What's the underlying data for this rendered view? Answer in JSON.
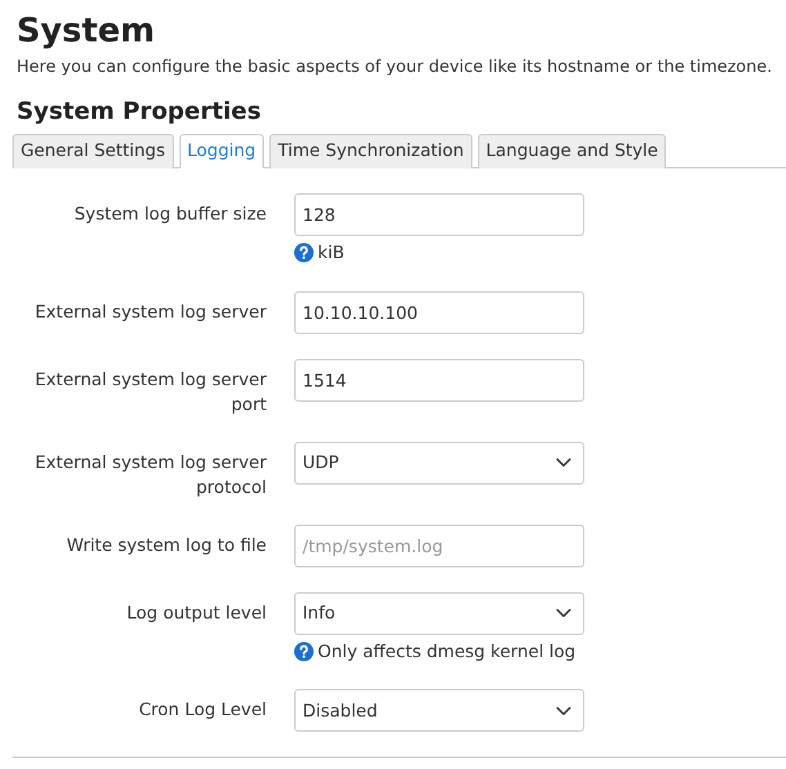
{
  "page": {
    "title": "System",
    "description": "Here you can configure the basic aspects of your device like its hostname or the timezone."
  },
  "section": {
    "title": "System Properties"
  },
  "tabs": [
    {
      "label": "General Settings",
      "selected": false
    },
    {
      "label": "Logging",
      "selected": true
    },
    {
      "label": "Time Synchronization",
      "selected": false
    },
    {
      "label": "Language and Style",
      "selected": false
    }
  ],
  "fields": [
    {
      "label": "System log buffer size",
      "kind": "text",
      "value": "128",
      "help": "kiB"
    },
    {
      "label": "External system log server",
      "kind": "text",
      "value": "10.10.10.100"
    },
    {
      "label": "External system log server port",
      "kind": "text",
      "value": "1514"
    },
    {
      "label": "External system log server protocol",
      "kind": "select",
      "value": "UDP"
    },
    {
      "label": "Write system log to file",
      "kind": "text",
      "placeholder": "/tmp/system.log"
    },
    {
      "label": "Log output level",
      "kind": "select",
      "value": "Info",
      "help": "Only affects dmesg kernel log"
    },
    {
      "label": "Cron Log Level",
      "kind": "select",
      "value": "Disabled"
    }
  ]
}
